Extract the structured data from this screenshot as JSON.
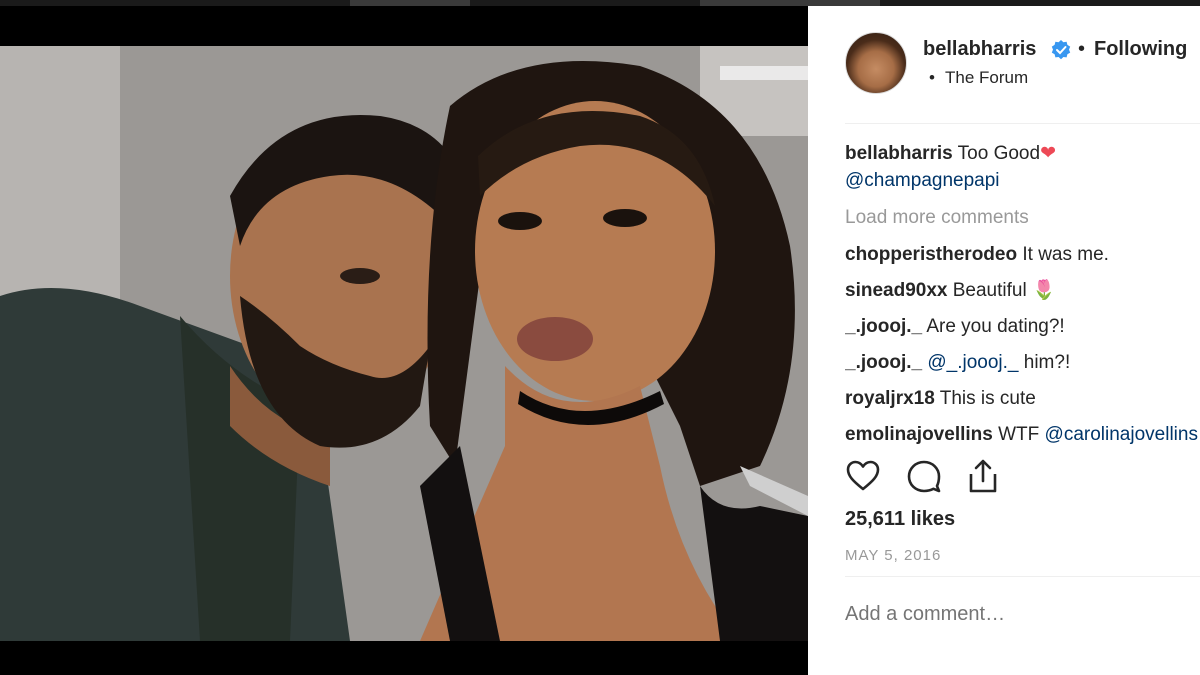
{
  "post": {
    "author": "bellabharris",
    "follow_label": "Following",
    "location": "The Forum",
    "caption_text": "Too Good",
    "caption_mention": "@champagnepapi",
    "load_more": "Load more comments",
    "comments": [
      {
        "user": "chopperistherodeo",
        "text": "It was me."
      },
      {
        "user": "sinead90xx",
        "text": "Beautiful 🌷"
      },
      {
        "user": "_.joooj._",
        "text": "Are you dating?!"
      },
      {
        "user": "_.joooj._",
        "mention": "@_.joooj._",
        "text": "him?!"
      },
      {
        "user": "royaljrx18",
        "text": "This is cute"
      },
      {
        "user": "emolinajovellins",
        "text": "WTF",
        "mention": "@carolinajovellins"
      }
    ],
    "likes": "25,611 likes",
    "date": "MAY 5, 2016",
    "add_comment_placeholder": "Add a comment…"
  },
  "icons": {
    "verified": "verified-badge-icon",
    "like": "heart-icon",
    "comment": "comment-bubble-icon",
    "share": "share-upload-icon"
  },
  "colors": {
    "accent_blue": "#3897f0",
    "mention": "#003569",
    "muted": "#999999",
    "heart_red": "#ed4956"
  }
}
